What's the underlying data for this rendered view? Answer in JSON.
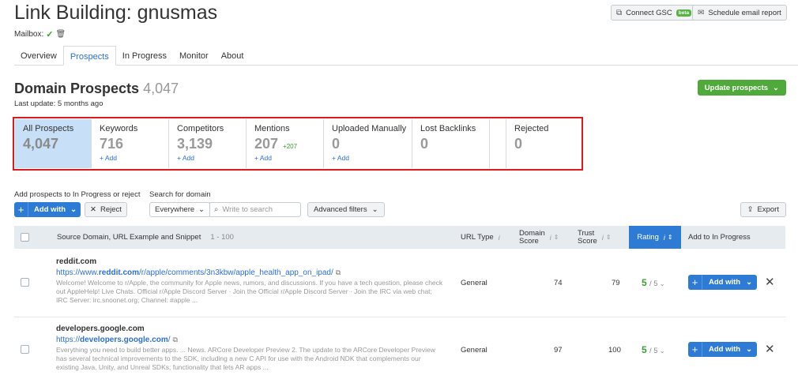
{
  "header": {
    "title": "Link Building: gnusmas",
    "mailbox_label": "Mailbox:",
    "connect_gsc": "Connect GSC",
    "connect_gsc_badge": "beta",
    "schedule_report": "Schedule email report"
  },
  "tabs": [
    {
      "label": "Overview",
      "active": false
    },
    {
      "label": "Prospects",
      "active": true
    },
    {
      "label": "In Progress",
      "active": false
    },
    {
      "label": "Monitor",
      "active": false
    },
    {
      "label": "About",
      "active": false
    }
  ],
  "section": {
    "title": "Domain Prospects",
    "count": "4,047",
    "last_update": "Last update: 5 months ago",
    "update_button": "Update prospects"
  },
  "cards": [
    {
      "label": "All Prospects",
      "value": "4,047",
      "delta": "",
      "add": ""
    },
    {
      "label": "Keywords",
      "value": "716",
      "delta": "",
      "add": "+ Add"
    },
    {
      "label": "Competitors",
      "value": "3,139",
      "delta": "",
      "add": "+ Add"
    },
    {
      "label": "Mentions",
      "value": "207",
      "delta": "+207",
      "add": "+ Add"
    },
    {
      "label": "Uploaded Manually",
      "value": "0",
      "delta": "",
      "add": "+ Add"
    },
    {
      "label": "Lost Backlinks",
      "value": "0",
      "delta": "",
      "add": ""
    },
    {
      "label": "",
      "value": "",
      "delta": "",
      "add": ""
    },
    {
      "label": "Rejected",
      "value": "0",
      "delta": "",
      "add": ""
    }
  ],
  "toolbar": {
    "add_label": "Add prospects to In Progress or reject",
    "add_with": "Add with",
    "reject": "Reject",
    "search_label": "Search for domain",
    "scope_value": "Everywhere",
    "search_placeholder": "Write to search",
    "advanced_filters": "Advanced filters",
    "export": "Export"
  },
  "table": {
    "col_source": "Source Domain, URL Example and Snippet",
    "col_range": "1 - 100",
    "col_url_type": "URL Type",
    "col_domain_score_1": "Domain",
    "col_domain_score_2": "Score",
    "col_trust_score_1": "Trust",
    "col_trust_score_2": "Score",
    "col_rating": "Rating",
    "col_add": "Add to In Progress",
    "rows": [
      {
        "domain": "reddit.com",
        "url_pre": "https://www.",
        "url_bold": "reddit.com",
        "url_post": "/r/apple/comments/3n3kbw/apple_health_app_on_ipad/",
        "snippet": "Welcome! Welcome to r/Apple, the community for Apple news, rumors, and discussions. If you have a tech question, please check out AppleHelp! Live Chats. Official r/Apple Discord Server · Join the Official r/Apple Discord Server · Join the IRC via web chat; IRC Server: irc.snoonet.org; Channel: #apple ...",
        "url_type": "General",
        "domain_score": "74",
        "trust_score": "79",
        "rating": "5",
        "rating_of": "/ 5",
        "add_with": "Add with"
      },
      {
        "domain": "developers.google.com",
        "url_pre": "https://",
        "url_bold": "developers.google.com",
        "url_post": "/",
        "snippet": "Everything you need to build better apps. ... News. ARCore Developer Preview 2. The update to the ARCore Developer Preview has several technical improvements to the SDK, including a new C API for use with the Android NDK that complements our existing Java, Unity, and Unreal SDKs; functionality that lets AR apps ...",
        "url_type": "General",
        "domain_score": "97",
        "trust_score": "100",
        "rating": "5",
        "rating_of": "/ 5",
        "add_with": "Add with"
      }
    ]
  },
  "colors": {
    "accent": "#2e7bd6",
    "green": "#4fa93b",
    "highlight_frame": "#e01a1a",
    "selected_card": "#c7dff7"
  }
}
